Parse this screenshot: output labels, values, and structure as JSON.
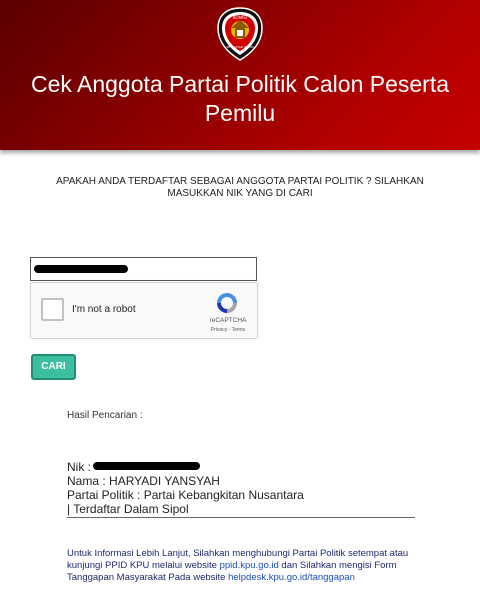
{
  "header": {
    "title": "Cek Anggota Partai Politik Calon Peserta Pemilu",
    "logo_top_text": "KOMISI",
    "logo_bottom_text": "PEMILIHAN UMUM",
    "colors": {
      "dark": "#5a0000",
      "light": "#c40000"
    }
  },
  "question": "APAKAH ANDA TERDAFTAR SEBAGAI ANGGOTA PARTAI POLITIK ? SILAHKAN MASUKKAN NIK YANG DI CARI",
  "nik_input": {
    "value": "",
    "redacted": true
  },
  "recaptcha": {
    "label": "I'm not a robot",
    "brand": "reCAPTCHA",
    "privacy": "Privacy",
    "terms": "Terms",
    "separator": " - "
  },
  "search_button": {
    "label": "CARI",
    "color": "#3cbfa0"
  },
  "result": {
    "heading": "Hasil Pencarian :",
    "nik_label": "Nik :",
    "name_label": "Nama :",
    "name_value": "HARYADI YANSYAH",
    "party_label": "Partai Politik :",
    "party_value": "Partai Kebangkitan Nusantara",
    "status": "| Terdaftar Dalam Sipol"
  },
  "info": {
    "line1": "Untuk Informasi Lebih Lanjut, Silahkan menghubungi Partai Politik setempat atau kunjungi PPID KPU melalui website",
    "ppid_link": "ppid.kpu.go.id",
    "line2": "dan Silahkan mengisi Form Tanggapan Masyarakat Pada website",
    "helpdesk_link": "helpdesk.kpu.go.id/tanggapan"
  }
}
